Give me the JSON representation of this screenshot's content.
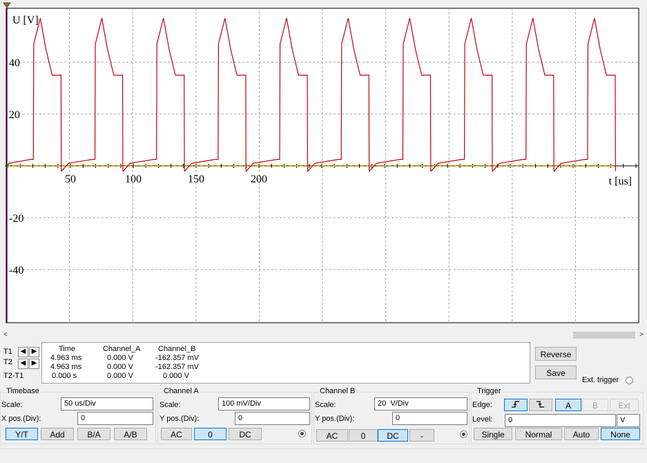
{
  "colors": {
    "trace_a": "#ccaa00",
    "trace_b": "#c0000f",
    "grid": "#a0a0a0",
    "cursor_t1": "#00aa00",
    "cursor_t2": "#cc33cc",
    "active": "#cce4f7"
  },
  "chart_data": {
    "type": "line",
    "xlabel": "t [us]",
    "ylabel": "U [V]",
    "x_ticks": [
      "50",
      "100",
      "150",
      "200"
    ],
    "y_ticks": [
      "40",
      "20",
      "-20",
      "-40"
    ],
    "grid": true,
    "period_us": 49,
    "pulses_start_us": [
      20.5,
      69.5,
      118.5,
      167.5,
      216.5,
      265.5,
      314.5,
      363.5,
      412.5,
      461.5
    ],
    "pulse_shape": {
      "peak_v": 57,
      "plateau_v": 35,
      "baseline_v": 1,
      "undershoot_v": -2,
      "rise_us": 5.5,
      "peak_time_us": 10,
      "plateau_time_us": 15,
      "high_width_us": 22
    },
    "trace_end_us": 485,
    "series": [
      {
        "name": "Channel_A",
        "color": "#ccaa00",
        "values_description": "flat 0 V"
      },
      {
        "name": "Channel_B",
        "color": "#c0000f"
      }
    ]
  },
  "scrollbar": {
    "left": "<",
    "right": ">"
  },
  "readout": {
    "headers": [
      "Time",
      "Channel_A",
      "Channel_B"
    ],
    "rows": [
      {
        "label": "T1",
        "time": "4.963 ms",
        "ch_a": "0.000 V",
        "ch_b": "-162.357 mV"
      },
      {
        "label": "T2",
        "time": "4.963 ms",
        "ch_a": "0.000 V",
        "ch_b": "-162.357 mV"
      },
      {
        "label": "T2-T1",
        "time": "0.000 s",
        "ch_a": "0.000 V",
        "ch_b": "0.000 V"
      }
    ]
  },
  "side": {
    "reverse": "Reverse",
    "save": "Save",
    "ext_trigger": "Ext. trigger"
  },
  "timebase": {
    "title": "Timebase",
    "scale_label": "Scale:",
    "scale": "50 us/Div",
    "xpos_label": "X pos.(Div):",
    "xpos": "0",
    "buttons": [
      "Y/T",
      "Add",
      "B/A",
      "A/B"
    ]
  },
  "channel_a": {
    "title": "Channel A",
    "scale_label": "Scale:",
    "scale": "100 mV/Div",
    "ypos_label": "Y pos.(Div):",
    "ypos": "0",
    "buttons": [
      "AC",
      "0",
      "DC"
    ]
  },
  "channel_b": {
    "title": "Channel B",
    "scale_label": "Scale:",
    "scale": "20  V/Div",
    "ypos_label": "Y pos.(Div):",
    "ypos": "0",
    "buttons": [
      "AC",
      "0",
      "DC",
      "-"
    ]
  },
  "trigger": {
    "title": "Trigger",
    "edge_label": "Edge:",
    "level_label": "Level:",
    "level": "0",
    "level_unit": "V",
    "sources": [
      "A",
      "B",
      "Ext"
    ],
    "modes": [
      "Single",
      "Normal",
      "Auto",
      "None"
    ]
  }
}
